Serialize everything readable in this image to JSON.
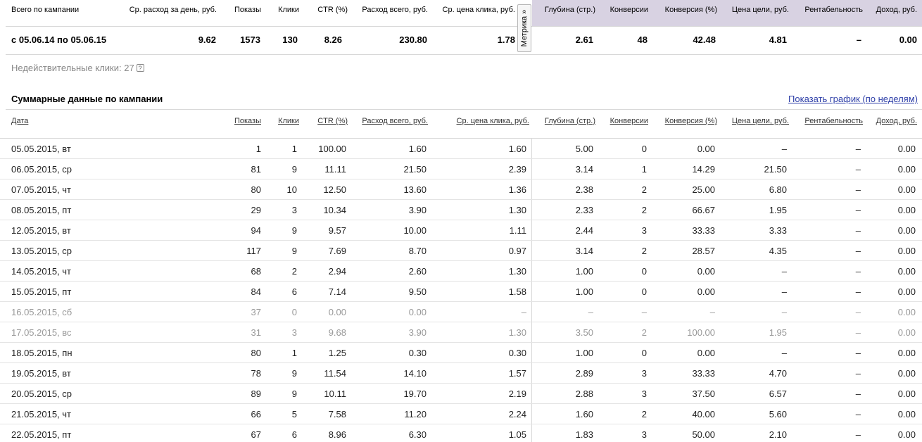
{
  "summary": {
    "headers": [
      "Всего по кампании",
      "Ср. расход за день, руб.",
      "Показы",
      "Клики",
      "CTR (%)",
      "Расход всего, руб.",
      "Ср. цена клика, руб.",
      "Глубина (стр.)",
      "Конверсии",
      "Конверсия (%)",
      "Цена цели, руб.",
      "Рентабельность",
      "Доход, руб."
    ],
    "values": [
      "с 05.06.14 по 05.06.15",
      "9.62",
      "1573",
      "130",
      "8.26",
      "230.80",
      "1.78",
      "2.61",
      "48",
      "42.48",
      "4.81",
      "–",
      "0.00"
    ]
  },
  "metrika_label": "Метрика »",
  "invalid_clicks": "Недействительные клики: 27",
  "help_icon": "?",
  "section_title": "Суммарные данные по кампании",
  "show_chart_link": "Показать график (по неделям)",
  "table": {
    "headers": [
      "Дата",
      "Показы",
      "Клики",
      "CTR (%)",
      "Расход всего, руб.",
      "Ср. цена клика, руб.",
      "Глубина (стр.)",
      "Конверсии",
      "Конверсия (%)",
      "Цена цели, руб.",
      "Рентабельность",
      "Доход, руб."
    ],
    "rows": [
      {
        "cells": [
          "05.05.2015, вт",
          "1",
          "1",
          "100.00",
          "1.60",
          "1.60",
          "5.00",
          "0",
          "0.00",
          "–",
          "–",
          "0.00"
        ],
        "dim": false
      },
      {
        "cells": [
          "06.05.2015, ср",
          "81",
          "9",
          "11.11",
          "21.50",
          "2.39",
          "3.14",
          "1",
          "14.29",
          "21.50",
          "–",
          "0.00"
        ],
        "dim": false
      },
      {
        "cells": [
          "07.05.2015, чт",
          "80",
          "10",
          "12.50",
          "13.60",
          "1.36",
          "2.38",
          "2",
          "25.00",
          "6.80",
          "–",
          "0.00"
        ],
        "dim": false
      },
      {
        "cells": [
          "08.05.2015, пт",
          "29",
          "3",
          "10.34",
          "3.90",
          "1.30",
          "2.33",
          "2",
          "66.67",
          "1.95",
          "–",
          "0.00"
        ],
        "dim": false
      },
      {
        "cells": [
          "12.05.2015, вт",
          "94",
          "9",
          "9.57",
          "10.00",
          "1.11",
          "2.44",
          "3",
          "33.33",
          "3.33",
          "–",
          "0.00"
        ],
        "dim": false
      },
      {
        "cells": [
          "13.05.2015, ср",
          "117",
          "9",
          "7.69",
          "8.70",
          "0.97",
          "3.14",
          "2",
          "28.57",
          "4.35",
          "–",
          "0.00"
        ],
        "dim": false
      },
      {
        "cells": [
          "14.05.2015, чт",
          "68",
          "2",
          "2.94",
          "2.60",
          "1.30",
          "1.00",
          "0",
          "0.00",
          "–",
          "–",
          "0.00"
        ],
        "dim": false
      },
      {
        "cells": [
          "15.05.2015, пт",
          "84",
          "6",
          "7.14",
          "9.50",
          "1.58",
          "1.00",
          "0",
          "0.00",
          "–",
          "–",
          "0.00"
        ],
        "dim": false
      },
      {
        "cells": [
          "16.05.2015, сб",
          "37",
          "0",
          "0.00",
          "0.00",
          "–",
          "–",
          "–",
          "–",
          "–",
          "–",
          "0.00"
        ],
        "dim": true
      },
      {
        "cells": [
          "17.05.2015, вс",
          "31",
          "3",
          "9.68",
          "3.90",
          "1.30",
          "3.50",
          "2",
          "100.00",
          "1.95",
          "–",
          "0.00"
        ],
        "dim": true
      },
      {
        "cells": [
          "18.05.2015, пн",
          "80",
          "1",
          "1.25",
          "0.30",
          "0.30",
          "1.00",
          "0",
          "0.00",
          "–",
          "–",
          "0.00"
        ],
        "dim": false
      },
      {
        "cells": [
          "19.05.2015, вт",
          "78",
          "9",
          "11.54",
          "14.10",
          "1.57",
          "2.89",
          "3",
          "33.33",
          "4.70",
          "–",
          "0.00"
        ],
        "dim": false
      },
      {
        "cells": [
          "20.05.2015, ср",
          "89",
          "9",
          "10.11",
          "19.70",
          "2.19",
          "2.88",
          "3",
          "37.50",
          "6.57",
          "–",
          "0.00"
        ],
        "dim": false
      },
      {
        "cells": [
          "21.05.2015, чт",
          "66",
          "5",
          "7.58",
          "11.20",
          "2.24",
          "1.60",
          "2",
          "40.00",
          "5.60",
          "–",
          "0.00"
        ],
        "dim": false
      },
      {
        "cells": [
          "22.05.2015, пт",
          "67",
          "6",
          "8.96",
          "6.30",
          "1.05",
          "1.83",
          "3",
          "50.00",
          "2.10",
          "–",
          "0.00"
        ],
        "dim": false
      }
    ]
  },
  "colors": {
    "metrika_panel_bg": "#d8d2e2",
    "link": "#2e3fa8",
    "dim_text": "#999999"
  }
}
